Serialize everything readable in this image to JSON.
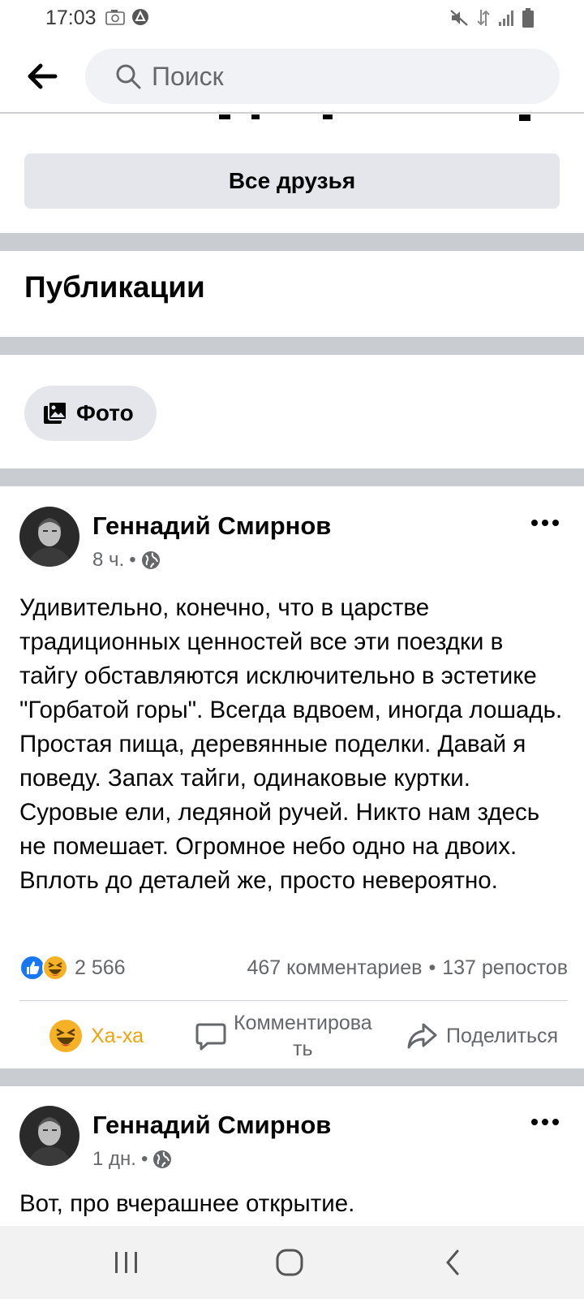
{
  "status_bar": {
    "time": "17:03"
  },
  "search": {
    "placeholder": "Поиск"
  },
  "friends": {
    "all_friends_label": "Все друзья"
  },
  "publications": {
    "title": "Публикации",
    "photo_chip_label": "Фото"
  },
  "posts": [
    {
      "author": "Геннадий Смирнов",
      "time": "8 ч.",
      "separator": "•",
      "text": "Удивительно, конечно, что в царстве традиционных ценностей все эти поездки в тайгу обставляются исключительно в эстетике \"Горбатой горы\". Всегда вдвоем, иногда лошадь. Простая пища, деревянные поделки. Давай я поведу. Запах тайги, одинаковые куртки. Суровые ели, ледяной ручей. Никто нам здесь не помешает. Огромное небо одно на двоих. Вплоть до деталей же, просто невероятно.",
      "reactions_count": "2 566",
      "comments": "467 комментариев",
      "stats_separator": "•",
      "shares": "137 репостов",
      "actions": {
        "react": "Ха-ха",
        "comment_line1": "Комментирова",
        "comment_line2": "ть",
        "share": "Поделиться"
      }
    },
    {
      "author": "Геннадий Смирнов",
      "time": "1 дн.",
      "separator": "•",
      "text": "Вот, про вчерашнее открытие."
    }
  ],
  "colors": {
    "divider": "#c9ccd1",
    "button_bg": "#e4e6eb",
    "haha": "#f7b125",
    "like": "#1877f2",
    "secondary_text": "#65676b"
  }
}
